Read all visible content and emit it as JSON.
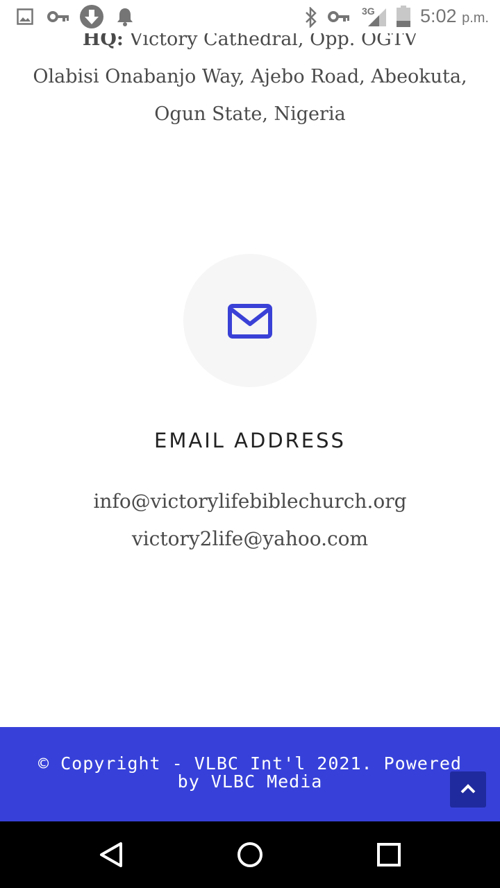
{
  "status_bar": {
    "time": "5:02",
    "ampm": "p.m.",
    "network": "3G",
    "icons": [
      "image-icon",
      "key-icon",
      "download-icon",
      "bell-icon",
      "bluetooth-icon",
      "key-icon",
      "signal-icon",
      "battery-icon"
    ]
  },
  "address": {
    "hq_label": "HQ:",
    "line1": " Victory Cathedral, Opp. OGTV",
    "line2": "Olabisi Onabanjo Way, Ajebo Road, Abeokuta,",
    "line3": "Ogun State, Nigeria"
  },
  "email_section": {
    "icon": "envelope-icon",
    "heading": "EMAIL ADDRESS",
    "emails": [
      "info@victorylifebiblechurch.org",
      "victory2life@yahoo.com"
    ]
  },
  "footer": {
    "copyright": "© Copyright - VLBC Int'l 2021. Powered by VLBC Media",
    "back_to_top_icon": "chevron-up-icon"
  },
  "colors": {
    "accent": "#3741d9",
    "accent_dark": "#1f2a9e",
    "icon_blue": "#3a41d6",
    "text": "#4a4a4a",
    "circle_bg": "#f6f6f6"
  },
  "nav_bar": {
    "buttons": [
      "back-triangle-icon",
      "home-circle-icon",
      "recents-square-icon"
    ]
  }
}
